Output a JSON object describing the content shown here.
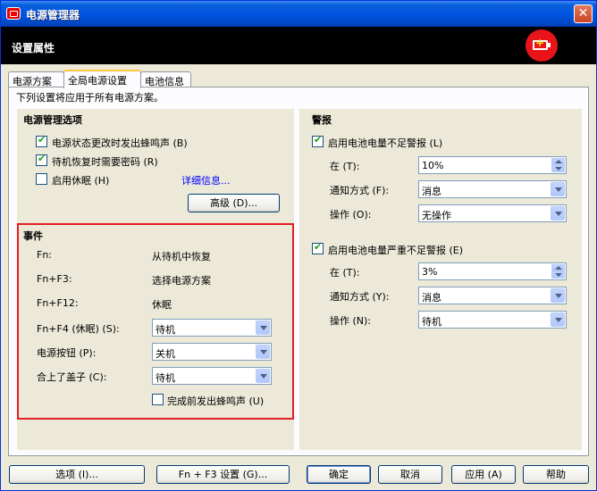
{
  "window": {
    "title": "电源管理器",
    "close_label": "✕",
    "header_title": "设置属性",
    "brand_color": "#e8141a"
  },
  "tabs": [
    {
      "label": "电源方案",
      "active": false
    },
    {
      "label": "全局电源设置",
      "active": true
    },
    {
      "label": "电池信息",
      "active": false
    }
  ],
  "intro_text": "下列设置将应用于所有电源方案。",
  "power_options": {
    "title": "电源管理选项",
    "beep_on_state_change": {
      "label": "电源状态更改时发出蜂鸣声 (B)",
      "checked": true
    },
    "password_on_resume": {
      "label": "待机恢复时需要密码 (R)",
      "checked": true
    },
    "enable_hibernate": {
      "label": "启用休眠 (H)",
      "checked": false
    },
    "details_link": "详细信息...",
    "advanced_button": "高级 (D)..."
  },
  "events": {
    "title": "事件",
    "fn_label": "Fn:",
    "fn_value": "从待机中恢复",
    "fn_f3_label": "Fn+F3:",
    "fn_f3_value": "选择电源方案",
    "fn_f12_label": "Fn+F12:",
    "fn_f12_value": "休眠",
    "fn_f4_label": "Fn+F4 (休眠) (S):",
    "fn_f4_value": "待机",
    "power_button_label": "电源按钮 (P):",
    "power_button_value": "关机",
    "lid_label": "合上了盖子 (C):",
    "lid_value": "待机",
    "beep_before_done": {
      "label": "完成前发出蜂鸣声 (U)",
      "checked": false
    }
  },
  "alarms": {
    "title": "警报",
    "low_battery": {
      "label": "启用电池电量不足警报 (L)",
      "checked": true,
      "at_label": "在 (T):",
      "at_value": "10%",
      "notify_label": "通知方式 (F):",
      "notify_value": "消息",
      "action_label": "操作 (O):",
      "action_value": "无操作"
    },
    "critical_battery": {
      "label": "启用电池电量严重不足警报 (E)",
      "checked": true,
      "at_label": "在 (T):",
      "at_value": "3%",
      "notify_label": "通知方式 (Y):",
      "notify_value": "消息",
      "action_label": "操作 (N):",
      "action_value": "待机"
    }
  },
  "footer": {
    "options_button": "选项 (I)...",
    "fn_f3_settings_button": "Fn + F3 设置 (G)...",
    "ok_button": "确定",
    "cancel_button": "取消",
    "apply_button": "应用 (A)",
    "help_button": "帮助"
  }
}
